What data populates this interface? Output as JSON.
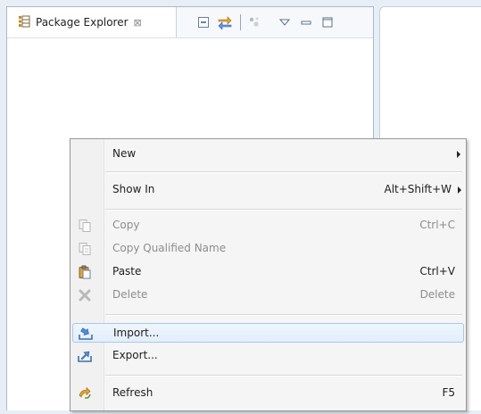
{
  "view": {
    "title": "Package Explorer",
    "close_glyph": "⊠",
    "icon": "package-explorer-icon",
    "toolbar": [
      "collapse-all-icon",
      "link-with-editor-icon",
      "focus-on-working-set-icon",
      "view-menu-icon",
      "minimize-icon",
      "maximize-icon"
    ]
  },
  "menu": {
    "items": [
      {
        "label": "New",
        "accel": "",
        "submenu": true,
        "enabled": true,
        "icon": ""
      },
      {
        "label": "Show In",
        "accel": "Alt+Shift+W",
        "submenu": true,
        "enabled": true,
        "icon": ""
      },
      {
        "label": "Copy",
        "accel": "Ctrl+C",
        "submenu": false,
        "enabled": false,
        "icon": "copy-icon"
      },
      {
        "label": "Copy Qualified Name",
        "accel": "",
        "submenu": false,
        "enabled": false,
        "icon": "copy-qualified-name-icon"
      },
      {
        "label": "Paste",
        "accel": "Ctrl+V",
        "submenu": false,
        "enabled": true,
        "icon": "paste-icon"
      },
      {
        "label": "Delete",
        "accel": "Delete",
        "submenu": false,
        "enabled": false,
        "icon": "delete-icon"
      },
      {
        "label": "Import...",
        "accel": "",
        "submenu": false,
        "enabled": true,
        "icon": "import-icon",
        "highlighted": true
      },
      {
        "label": "Export...",
        "accel": "",
        "submenu": false,
        "enabled": true,
        "icon": "export-icon"
      },
      {
        "label": "Refresh",
        "accel": "F5",
        "submenu": false,
        "enabled": true,
        "icon": "refresh-icon"
      }
    ]
  },
  "colors": {
    "menu_bg": "#f5f5f5",
    "highlight_border": "#a8c8eb",
    "disabled_text": "#8d8d8d"
  }
}
